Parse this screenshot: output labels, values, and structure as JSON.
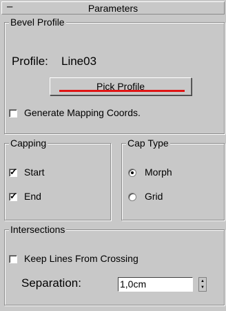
{
  "rollout": {
    "toggle_symbol": "–",
    "title": "Parameters"
  },
  "bevel_profile": {
    "legend": "Bevel Profile",
    "profile_label": "Profile:",
    "profile_value": "Line03",
    "pick_button": "Pick Profile",
    "mapping_label": "Generate Mapping Coords.",
    "mapping_checked": false
  },
  "capping": {
    "legend": "Capping",
    "start_label": "Start",
    "start_checked": true,
    "end_label": "End",
    "end_checked": true
  },
  "cap_type": {
    "legend": "Cap Type",
    "morph_label": "Morph",
    "grid_label": "Grid",
    "selected": "Morph"
  },
  "intersections": {
    "legend": "Intersections",
    "keep_lines_label": "Keep Lines From Crossing",
    "keep_lines_checked": false,
    "separation_label": "Separation:",
    "separation_value": "1,0cm"
  },
  "colors": {
    "panel_bg": "#c8c8c8",
    "underline_accent": "#e01414"
  },
  "icons": {
    "check": "check-icon",
    "spinner": "spinner-arrows-icon"
  }
}
